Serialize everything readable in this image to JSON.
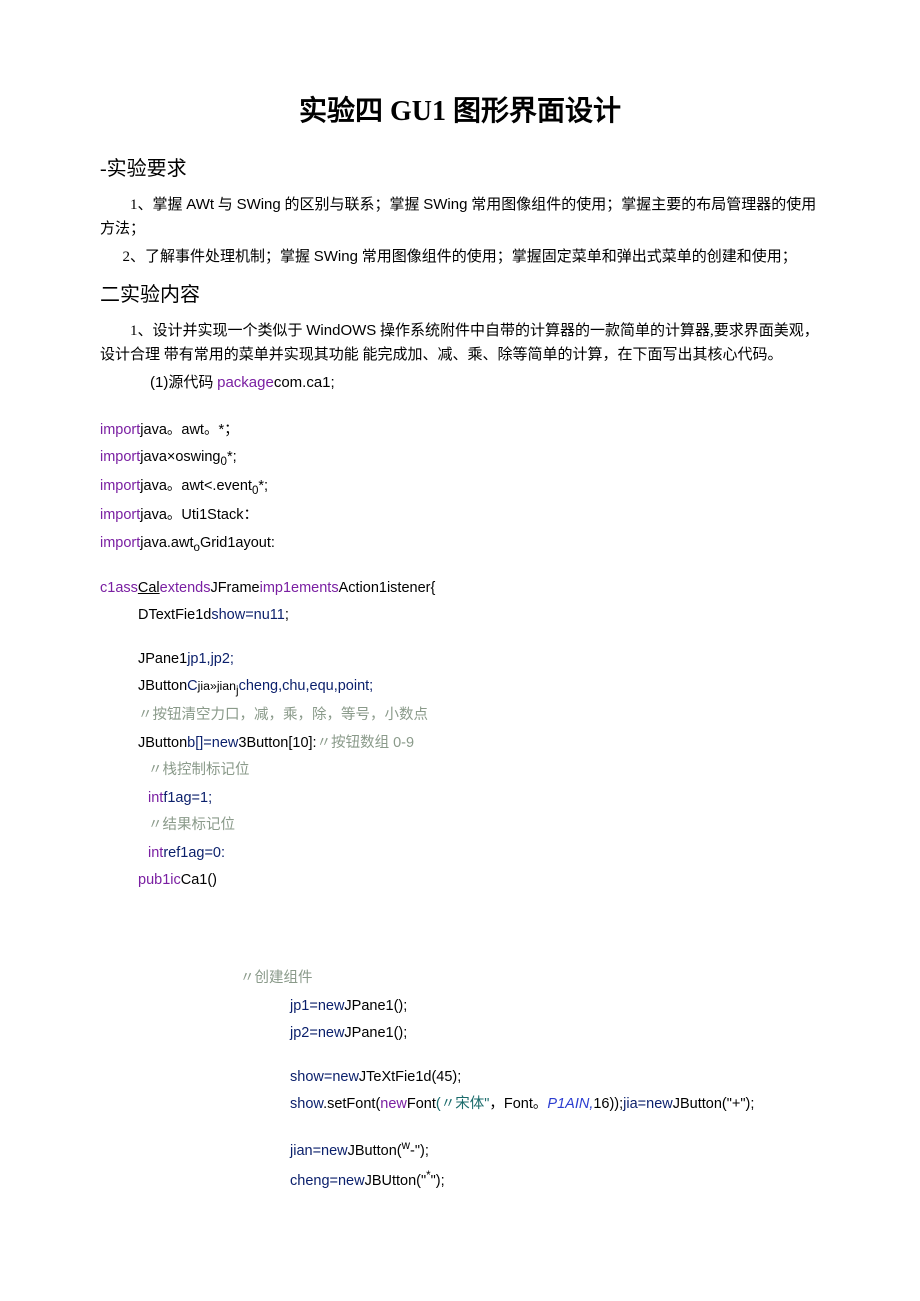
{
  "title_pre": "实验四 ",
  "title_roman": "GU1",
  "title_post": " 图形界面设计",
  "h1": "-实验要求",
  "p1a": "1、掌握 ",
  "p1b": "AWt",
  "p1c": " 与 ",
  "p1d": "SWing",
  "p1e": " 的区别与联系；掌握 ",
  "p1f": "SWing",
  "p1g": " 常用图像组件的使用；掌握主要的布局管理器的使用方法；",
  "p2a": "2、了解事件处理机制；掌握 ",
  "p2b": "SWing",
  "p2c": " 常用图像组件的使用；掌握固定菜单和弹出式菜单的创建和使用；",
  "h2": "二实验内容",
  "p3a": "1、设计并实现一个类似于 ",
  "p3b": "WindOWS",
  "p3c": " 操作系统附件中自带的计算器的一款简单的计算器,要求界面美观，设计合理 带有常用的菜单并实现其功能 能完成加、减、乘、除等简单的计算，在下面写出其核心代码。",
  "p4a": "(1)",
  "p4b": "源代码 ",
  "p4c": "package",
  "p4d": "com.ca1;",
  "c1": "import",
  "c1b": "java。awt。*；",
  "c2": "import",
  "c2b": "java×oswing",
  "c2c": "0",
  "c2d": "*;",
  "c3": "import",
  "c3b": "java。awt<.event",
  "c3c": "0",
  "c3d": "*;",
  "c4": "import",
  "c4b": "java。Uti1Stack：",
  "c5": "import",
  "c5b": "java.awt",
  "c5c": "o",
  "c5d": "Grid1ayout:",
  "c6": "c1ass",
  "c6b": "Cal",
  "c6c": "extends",
  "c6d": "JFrame",
  "c6e": "imp1ements",
  "c6f": "Action1istener{",
  "c7": "DTextFie1d",
  "c7b": "show=nu11",
  "c7c": ";",
  "c8": "JPane1",
  "c8b": "jp1,jp2;",
  "c9": "JButton",
  "c9b": "C",
  "c9c": "jia»jian",
  "c9d": "j",
  "c9e": "cheng,chu,equ,point;",
  "c10": "〃按钮清空力口，减，乘，除，等号，小数点",
  "c11a": "JButton",
  "c11b": "b[]=new",
  "c11c": "3Button[10]:",
  "c11d": "〃按钮数组 0-9",
  "c12": "〃栈控制标记位",
  "c13a": "int",
  "c13b": "f1ag=1;",
  "c14": "〃结果标记位",
  "c15a": "int",
  "c15b": "ref1ag=0:",
  "c16a": "pub1ic",
  "c16b": "Ca1()",
  "c17": "〃创建组件",
  "c18a": "jp1=new",
  "c18b": "JPane1();",
  "c19a": "jp2=new",
  "c19b": "JPane1();",
  "c20a": "show=new",
  "c20b": "JTeXtFie1d(45);",
  "c21a": "show",
  "c21b": ".setFont(",
  "c21c": "new",
  "c21d": "Font",
  "c21e": "(〃宋体\"",
  "c21f": "，Font。",
  "c21g": "P1AIN,",
  "c21h": "16));",
  "c21i": "jia=new",
  "c21j": "JButton(\"+\");",
  "c22a": "jian=new",
  "c22b": "JButton(",
  "c22c": "w",
  "c22d": "-\");",
  "c23a": "cheng=new",
  "c23b": "JBUtton(\"",
  "c23c": "*",
  "c23d": "\");"
}
